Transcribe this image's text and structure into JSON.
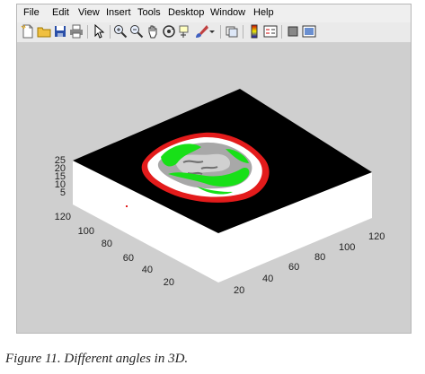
{
  "menu": [
    "File",
    "Edit",
    "View",
    "Insert",
    "Tools",
    "Desktop",
    "Window",
    "Help"
  ],
  "toolbar": [
    "new-file-icon",
    "open-folder-icon",
    "save-icon",
    "print-icon",
    "pointer-icon",
    "zoom-in-icon",
    "zoom-out-icon",
    "pan-hand-icon",
    "rotate-3d-icon",
    "data-cursor-icon",
    "brush-icon",
    "link-plot-icon",
    "colorbar-icon",
    "legend-icon",
    "hide-plot-tools-icon",
    "show-plot-tools-icon"
  ],
  "axes": {
    "z_ticks": [
      "25",
      "20",
      "15",
      "10",
      "5"
    ],
    "y_ticks": [
      "120",
      "100",
      "80",
      "60",
      "40",
      "20"
    ],
    "x_ticks": [
      "20",
      "40",
      "60",
      "80",
      "100",
      "120"
    ]
  },
  "colors": {
    "surface_top": "#000000",
    "contour_outer": "#e31b1b",
    "contour_ring": "#ffffff",
    "segmentation": "#18e018",
    "tissue": "#a8a8a8",
    "figure_bg": "#cfcfcf"
  },
  "caption": {
    "label": "Figure 11.",
    "text": "Different angles in 3D."
  }
}
